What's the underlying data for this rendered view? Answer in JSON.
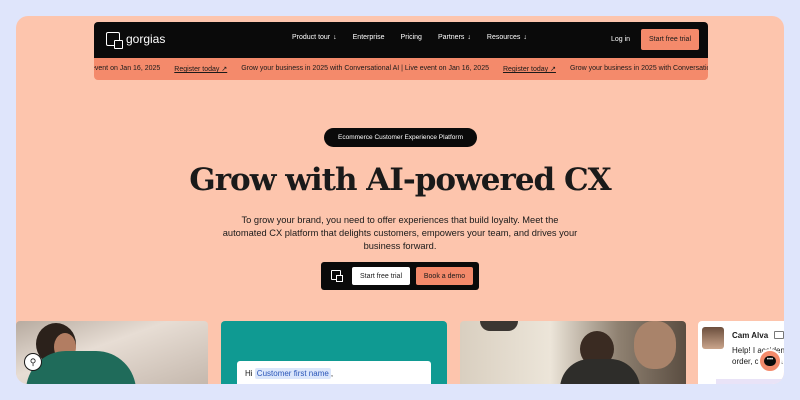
{
  "nav": {
    "brand": "gorgias",
    "links": [
      {
        "label": "Product tour",
        "dropdown": true
      },
      {
        "label": "Enterprise",
        "dropdown": false
      },
      {
        "label": "Pricing",
        "dropdown": false
      },
      {
        "label": "Partners",
        "dropdown": true
      },
      {
        "label": "Resources",
        "dropdown": true
      }
    ],
    "login": "Log in",
    "cta": "Start free trial"
  },
  "ticker": {
    "lead_fragment": "event on Jan 16, 2025",
    "register": "Register today ↗",
    "message": "Grow your business in 2025 with Conversational AI | Live event on Jan 16, 2025"
  },
  "hero": {
    "pill": "Ecommerce Customer Experience Platform",
    "headline": "Grow with AI-powered CX",
    "subtext": "To grow your brand, you need to offer experiences that build loyalty. Meet the automated CX platform that delights customers, empowers your team, and drives your business forward.",
    "cta_trial": "Start free trial",
    "cta_demo": "Book a demo"
  },
  "cards": {
    "message_greeting": "Hi",
    "message_token": "Customer first name",
    "message_punct": ",",
    "chat_name": "Cam Alva",
    "chat_line1": "Help! I accident",
    "chat_line2": "order, can I ca"
  },
  "colors": {
    "background": "#fdc5ad",
    "accent": "#f48a6b",
    "dark": "#0a0a0a",
    "teal": "#0f9a92"
  }
}
